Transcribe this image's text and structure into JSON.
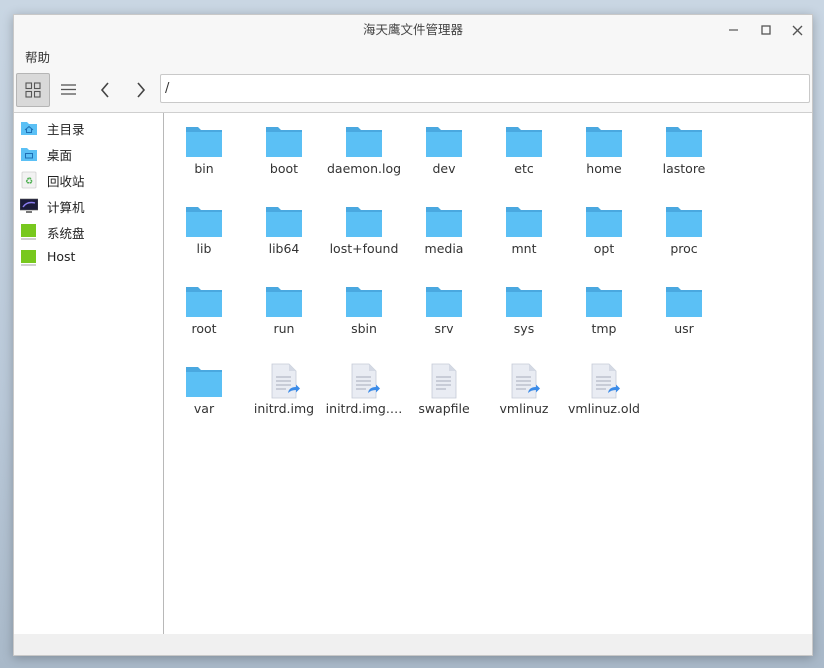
{
  "window": {
    "title": "海天鹰文件管理器"
  },
  "menu": {
    "items": [
      "帮助"
    ]
  },
  "toolbar": {
    "path": "/"
  },
  "sidebar": {
    "items": [
      {
        "label": "主目录",
        "icon": "home-folder-icon"
      },
      {
        "label": "桌面",
        "icon": "desktop-folder-icon"
      },
      {
        "label": "回收站",
        "icon": "trash-icon"
      },
      {
        "label": "计算机",
        "icon": "computer-icon"
      },
      {
        "label": "系统盘",
        "icon": "drive-icon"
      },
      {
        "label": "Host",
        "icon": "drive-icon"
      }
    ]
  },
  "files": [
    {
      "name": "bin",
      "type": "folder"
    },
    {
      "name": "boot",
      "type": "folder"
    },
    {
      "name": "daemon.log",
      "type": "folder"
    },
    {
      "name": "dev",
      "type": "folder"
    },
    {
      "name": "etc",
      "type": "folder"
    },
    {
      "name": "home",
      "type": "folder"
    },
    {
      "name": "lastore",
      "type": "folder"
    },
    {
      "name": "lib",
      "type": "folder"
    },
    {
      "name": "lib64",
      "type": "folder"
    },
    {
      "name": "lost+found",
      "type": "folder"
    },
    {
      "name": "media",
      "type": "folder"
    },
    {
      "name": "mnt",
      "type": "folder"
    },
    {
      "name": "opt",
      "type": "folder"
    },
    {
      "name": "proc",
      "type": "folder"
    },
    {
      "name": "root",
      "type": "folder"
    },
    {
      "name": "run",
      "type": "folder"
    },
    {
      "name": "sbin",
      "type": "folder"
    },
    {
      "name": "srv",
      "type": "folder"
    },
    {
      "name": "sys",
      "type": "folder"
    },
    {
      "name": "tmp",
      "type": "folder"
    },
    {
      "name": "usr",
      "type": "folder"
    },
    {
      "name": "var",
      "type": "folder"
    },
    {
      "name": "initrd.img",
      "type": "link"
    },
    {
      "name": "initrd.img.…",
      "type": "link"
    },
    {
      "name": "swapfile",
      "type": "file"
    },
    {
      "name": "vmlinuz",
      "type": "link"
    },
    {
      "name": "vmlinuz.old",
      "type": "link"
    }
  ],
  "colors": {
    "folder": "#5bc0f5",
    "folder_dark": "#4aa8e0",
    "accent": "#3b8be8"
  }
}
